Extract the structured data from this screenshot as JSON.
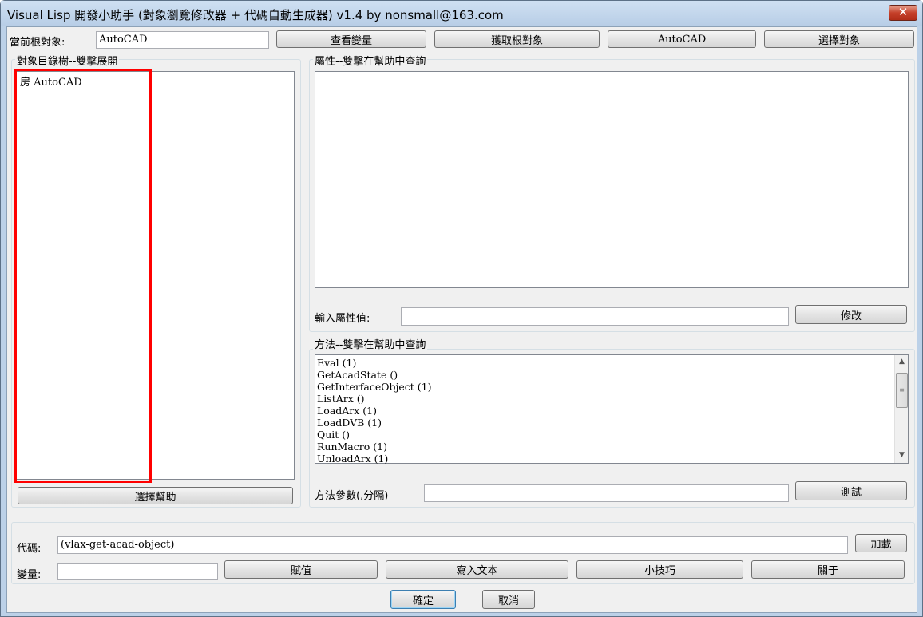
{
  "window": {
    "title": "Visual Lisp 開發小助手 (對象瀏覽修改器 + 代碼自動生成器) v1.4 by nonsmall@163.com",
    "close_glyph": "✕"
  },
  "top": {
    "root_label": "當前根對象:",
    "root_value": "AutoCAD",
    "buttons": [
      "查看變量",
      "獲取根對象",
      "AutoCAD",
      "選擇對象"
    ]
  },
  "tree": {
    "group_title": "對象目錄樹--雙擊展開",
    "items": [
      {
        "prefix": "房",
        "label": "AutoCAD"
      }
    ],
    "help_button": "選擇幫助"
  },
  "properties": {
    "group_title": "屬性--雙擊在幫助中查詢",
    "input_label": "輸入屬性值:",
    "input_value": "",
    "modify_button": "修改"
  },
  "methods": {
    "group_title": "方法--雙擊在幫助中查詢",
    "items": [
      "Eval (1)",
      "GetAcadState ()",
      "GetInterfaceObject (1)",
      "ListArx ()",
      "LoadArx (1)",
      "LoadDVB (1)",
      "Quit ()",
      "RunMacro (1)",
      "UnloadArx (1)"
    ],
    "param_label": "方法參數(,分隔)",
    "param_value": "",
    "test_button": "測試"
  },
  "code": {
    "code_label": "代碼:",
    "code_value": "(vlax-get-acad-object)",
    "load_button": "加載",
    "var_label": "變量:",
    "var_value": "",
    "buttons": [
      "賦值",
      "寫入文本",
      "小技巧",
      "關于"
    ]
  },
  "footer": {
    "ok": "確定",
    "cancel": "取消"
  },
  "colors": {
    "highlight": "#ff0000",
    "title_bar": "#bcd1e8",
    "close_button": "#c5402a"
  }
}
